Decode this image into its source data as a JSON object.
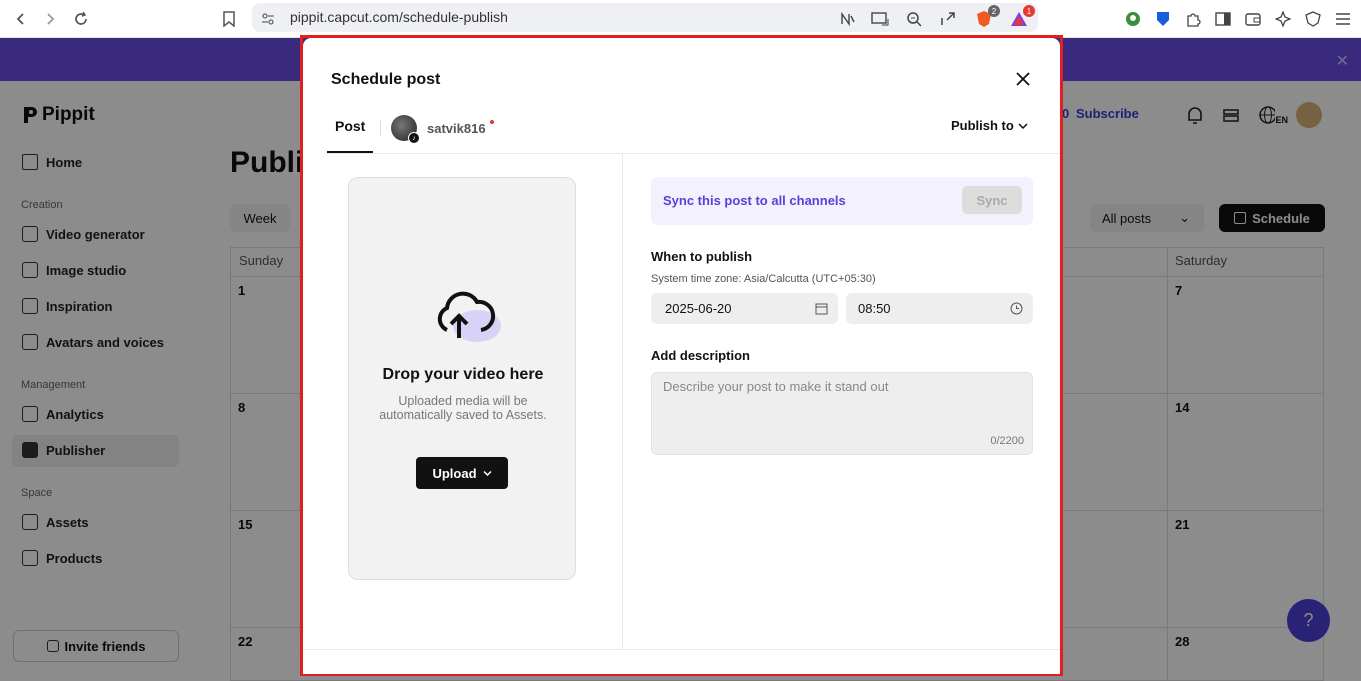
{
  "browser": {
    "url": "pippit.capcut.com/schedule-publish",
    "brave_badge": "2",
    "alert_badge": "1"
  },
  "app": {
    "logo": "Pippit",
    "sidebar": {
      "home": "Home",
      "section_creation": "Creation",
      "video_generator": "Video generator",
      "image_studio": "Image studio",
      "inspiration": "Inspiration",
      "avatars_voices": "Avatars and voices",
      "section_management": "Management",
      "analytics": "Analytics",
      "publisher": "Publisher",
      "section_space": "Space",
      "assets": "Assets",
      "products": "Products",
      "invite": "Invite friends"
    },
    "page_title": "Publi",
    "week": "Week",
    "all_posts": "All posts",
    "schedule": "Schedule",
    "credits": "0",
    "subscribe": "Subscribe",
    "lang": "EN",
    "calendar": {
      "sunday": "Sunday",
      "saturday": "Saturday",
      "sun_days": [
        "1",
        "8",
        "15",
        "22"
      ],
      "sat_days": [
        "7",
        "14",
        "21",
        "28"
      ]
    }
  },
  "modal": {
    "title": "Schedule post",
    "tab_post": "Post",
    "account_name": "satvik816",
    "publish_to": "Publish to",
    "drop_title": "Drop your video here",
    "drop_sub": "Uploaded media will be automatically saved to Assets.",
    "upload": "Upload",
    "sync_text": "Sync this post to all channels",
    "sync_btn": "Sync",
    "when_label": "When to publish",
    "tz_label": "System time zone: Asia/Calcutta (UTC+05:30)",
    "date": "2025-06-20",
    "time": "08:50",
    "desc_label": "Add description",
    "desc_placeholder": "Describe your post to make it stand out",
    "desc_count": "0/2200"
  },
  "colors": {
    "accent": "#6b4de6",
    "sync_text": "#5b3fd6",
    "frame": "#e02020"
  }
}
